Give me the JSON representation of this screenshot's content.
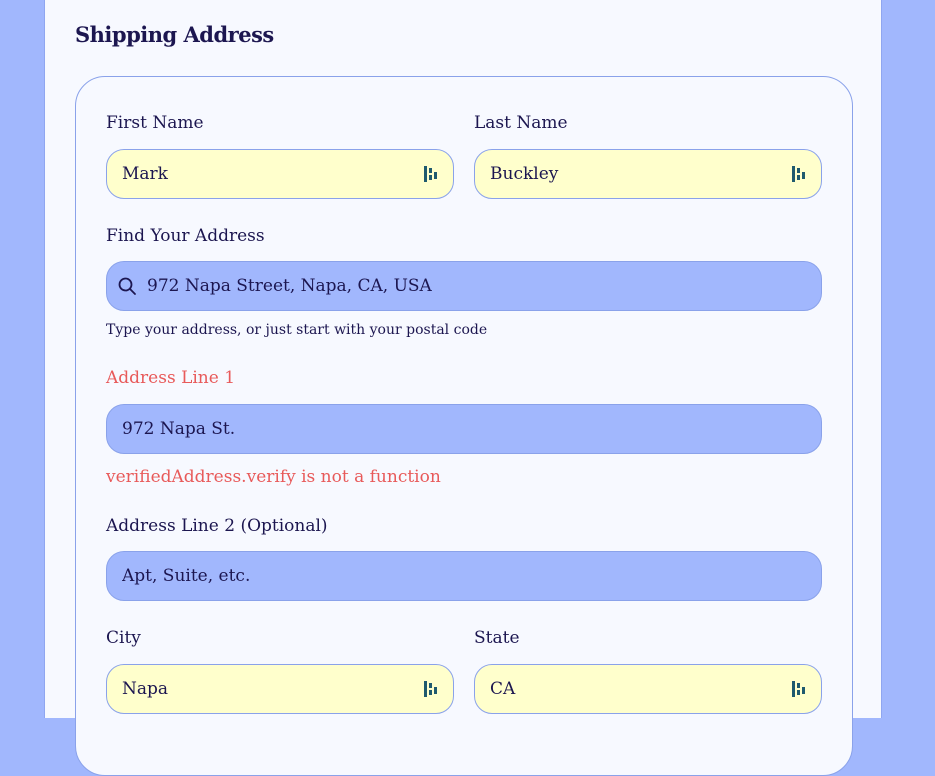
{
  "section": {
    "title": "Shipping Address"
  },
  "first_name": {
    "label": "First Name",
    "value": "Mark",
    "icon": "password-manager-icon"
  },
  "last_name": {
    "label": "Last Name",
    "value": "Buckley",
    "icon": "password-manager-icon"
  },
  "find_address": {
    "label": "Find Your Address",
    "value": "972 Napa Street, Napa, CA, USA",
    "icon": "search-icon",
    "hint": "Type your address, or just start with your postal code"
  },
  "address_line_1": {
    "label": "Address Line 1",
    "value": "972 Napa St.",
    "error": "verifiedAddress.verify is not a function"
  },
  "address_line_2": {
    "label": "Address Line 2 (Optional)",
    "placeholder": "Apt, Suite, etc."
  },
  "city": {
    "label": "City",
    "value": "Napa",
    "icon": "password-manager-icon"
  },
  "state": {
    "label": "State",
    "value": "CA",
    "icon": "password-manager-icon"
  },
  "colors": {
    "page_background": "#a1b7fd",
    "card_background": "#f7f9ff",
    "autofill_field": "#ffffcc",
    "field_blue": "#a1b7fd",
    "text": "#1c1650",
    "error": "#e85a5a",
    "border": "#8aa2ea"
  }
}
